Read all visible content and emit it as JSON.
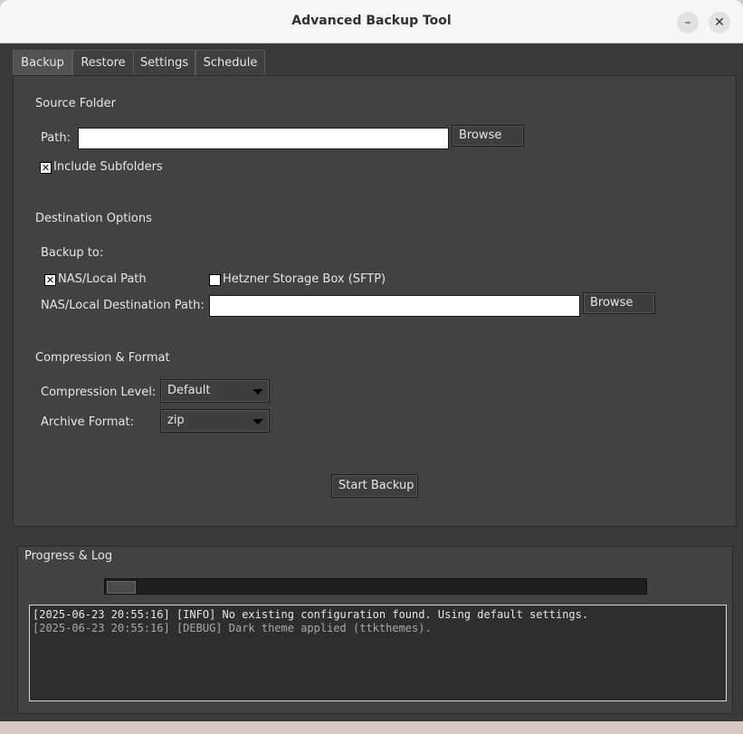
{
  "window": {
    "title": "Advanced Backup Tool",
    "minimize_glyph": "–",
    "close_glyph": "✕"
  },
  "tabs": [
    {
      "label": "Backup",
      "active": true
    },
    {
      "label": "Restore"
    },
    {
      "label": "Settings"
    },
    {
      "label": "Schedule"
    }
  ],
  "source": {
    "heading": "Source Folder",
    "path_label": "Path:",
    "path_value": "",
    "browse_label": "Browse",
    "include_subfolders_label": "Include Subfolders",
    "include_subfolders_checked": true
  },
  "destination": {
    "heading": "Destination Options",
    "backup_to_label": "Backup to:",
    "nas_label": "NAS/Local Path",
    "nas_checked": true,
    "hetzner_label": "Hetzner Storage Box (SFTP)",
    "hetzner_checked": false,
    "nas_path_label": "NAS/Local Destination Path:",
    "nas_path_value": "",
    "browse_label": "Browse"
  },
  "compression": {
    "heading": "Compression & Format",
    "level_label": "Compression Level:",
    "level_value": "Default",
    "format_label": "Archive Format:",
    "format_value": "zip"
  },
  "actions": {
    "start_backup_label": "Start Backup"
  },
  "log": {
    "heading": "Progress & Log",
    "progress_percent": 5,
    "lines": [
      {
        "text": "[2025-06-23 20:55:16] [INFO] No existing configuration found. Using default settings.",
        "color": "#e6e6e6"
      },
      {
        "text": "[2025-06-23 20:55:16] [DEBUG] Dark theme applied (ttkthemes).",
        "color": "#a8a8a8"
      }
    ]
  }
}
